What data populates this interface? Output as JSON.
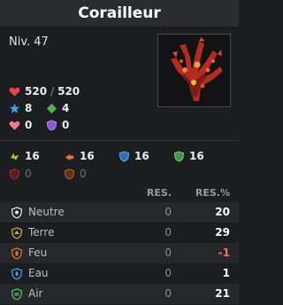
{
  "window": {
    "title": "Corailleur"
  },
  "level": "Niv. 47",
  "portrait": {
    "icon": "coral-monster-portrait"
  },
  "vitals": {
    "hp_current": "520",
    "hp_sep": "/",
    "hp_max": "520",
    "ap": "8",
    "mp": "4",
    "shield_hp": "0",
    "shield_purple": "0"
  },
  "resistance_mods": [
    [
      {
        "icon": "earth-damage-icon",
        "value": "16",
        "active": true
      },
      {
        "icon": "fire-damage-icon",
        "value": "16",
        "active": true
      },
      {
        "icon": "water-shield-icon",
        "value": "16",
        "active": true
      },
      {
        "icon": "air-shield-icon",
        "value": "16",
        "active": true
      }
    ],
    [
      {
        "icon": "neutral-shield-icon",
        "value": "0",
        "active": false
      },
      {
        "icon": "fire-shield-icon",
        "value": "0",
        "active": false
      }
    ]
  ],
  "table": {
    "col_res": "RES.",
    "col_res_pct": "RES.%",
    "rows": [
      {
        "icon": "neutral-icon",
        "name": "Neutre",
        "res": "0",
        "res_pct": "20",
        "negative": false
      },
      {
        "icon": "earth-icon",
        "name": "Terre",
        "res": "0",
        "res_pct": "29",
        "negative": false
      },
      {
        "icon": "fire-icon",
        "name": "Feu",
        "res": "0",
        "res_pct": "-1",
        "negative": true
      },
      {
        "icon": "water-icon",
        "name": "Eau",
        "res": "0",
        "res_pct": "1",
        "negative": false
      },
      {
        "icon": "air-icon",
        "name": "Air",
        "res": "0",
        "res_pct": "21",
        "negative": false
      }
    ]
  },
  "colors": {
    "background": "#1c1d20",
    "title_bar": "#2b2c2f",
    "negative": "#ff6b5a",
    "heart": "#e8434d",
    "ap_star": "#3aa0e0",
    "mp_diamond": "#4cb54c"
  }
}
